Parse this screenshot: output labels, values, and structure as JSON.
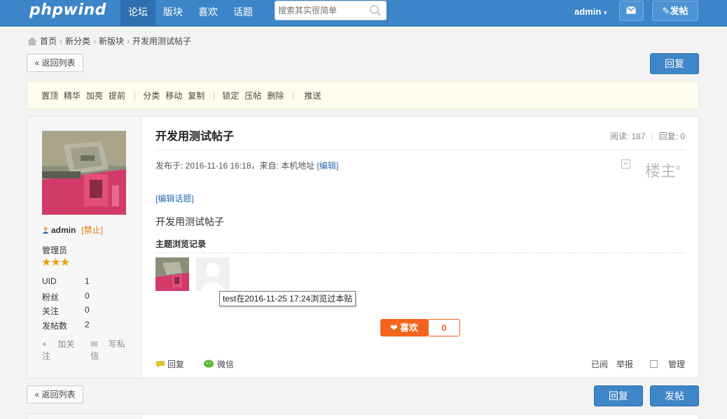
{
  "header": {
    "logo": "phpwind",
    "nav": [
      "论坛",
      "版块",
      "喜欢",
      "话题"
    ],
    "search_placeholder": "搜索其实很简单",
    "user": "admin",
    "post_button": "发帖",
    "colors": {
      "bar": "#3c85c8",
      "active": "#2e6fb0"
    }
  },
  "breadcrumb": [
    "首页",
    "新分类",
    "新版块",
    "开发用测试帖子"
  ],
  "toolbar": {
    "back_label": "« 返回列表",
    "reply_label": "回复",
    "post_label": "发帖"
  },
  "modbar": {
    "group1": [
      "置顶",
      "精华",
      "加亮",
      "提前"
    ],
    "group2": [
      "分类",
      "移动",
      "复制"
    ],
    "group3": [
      "锁定",
      "压帖",
      "删除"
    ],
    "group4": [
      "推送"
    ]
  },
  "author": {
    "name": "admin",
    "ban": "[禁止]",
    "role": "管理员",
    "stars": "★★★",
    "stats": [
      {
        "k": "UID",
        "v": "1"
      },
      {
        "k": "粉丝",
        "v": "0"
      },
      {
        "k": "关注",
        "v": "0"
      },
      {
        "k": "发帖数",
        "v": "2"
      }
    ],
    "follow": "加关注",
    "message": "写私信"
  },
  "post": {
    "title": "开发用测试帖子",
    "read_label": "阅读: 187",
    "reply_label": "回复: 0",
    "meta": "发布于: 2016-11-16 16:18，来自: 本机地址",
    "edit_link": "[编辑]",
    "floor": "楼主",
    "floor_mark": "#",
    "edit_topic": "[编辑话题]",
    "content": "开发用测试帖子",
    "view_record_title": "主题浏览记录",
    "tooltip": "test在2016-11-25 17:24浏览过本贴",
    "like_label": "喜欢",
    "like_count": "0",
    "reply": "回复",
    "wechat": "微信",
    "read": "已阅",
    "report": "举报",
    "manage": "管理"
  }
}
